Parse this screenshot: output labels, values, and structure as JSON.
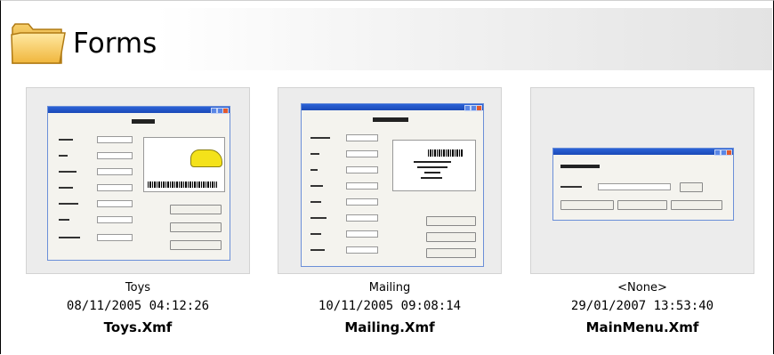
{
  "header": {
    "title": "Forms",
    "icon": "folder-icon"
  },
  "forms": [
    {
      "name": "Toys",
      "date": "08/11/2005 04:12:26",
      "file": "Toys.Xmf"
    },
    {
      "name": "Mailing",
      "date": "10/11/2005 09:08:14",
      "file": "Mailing.Xmf"
    },
    {
      "name": "<None>",
      "date": "29/01/2007 13:53:40",
      "file": "MainMenu.Xmf"
    }
  ]
}
